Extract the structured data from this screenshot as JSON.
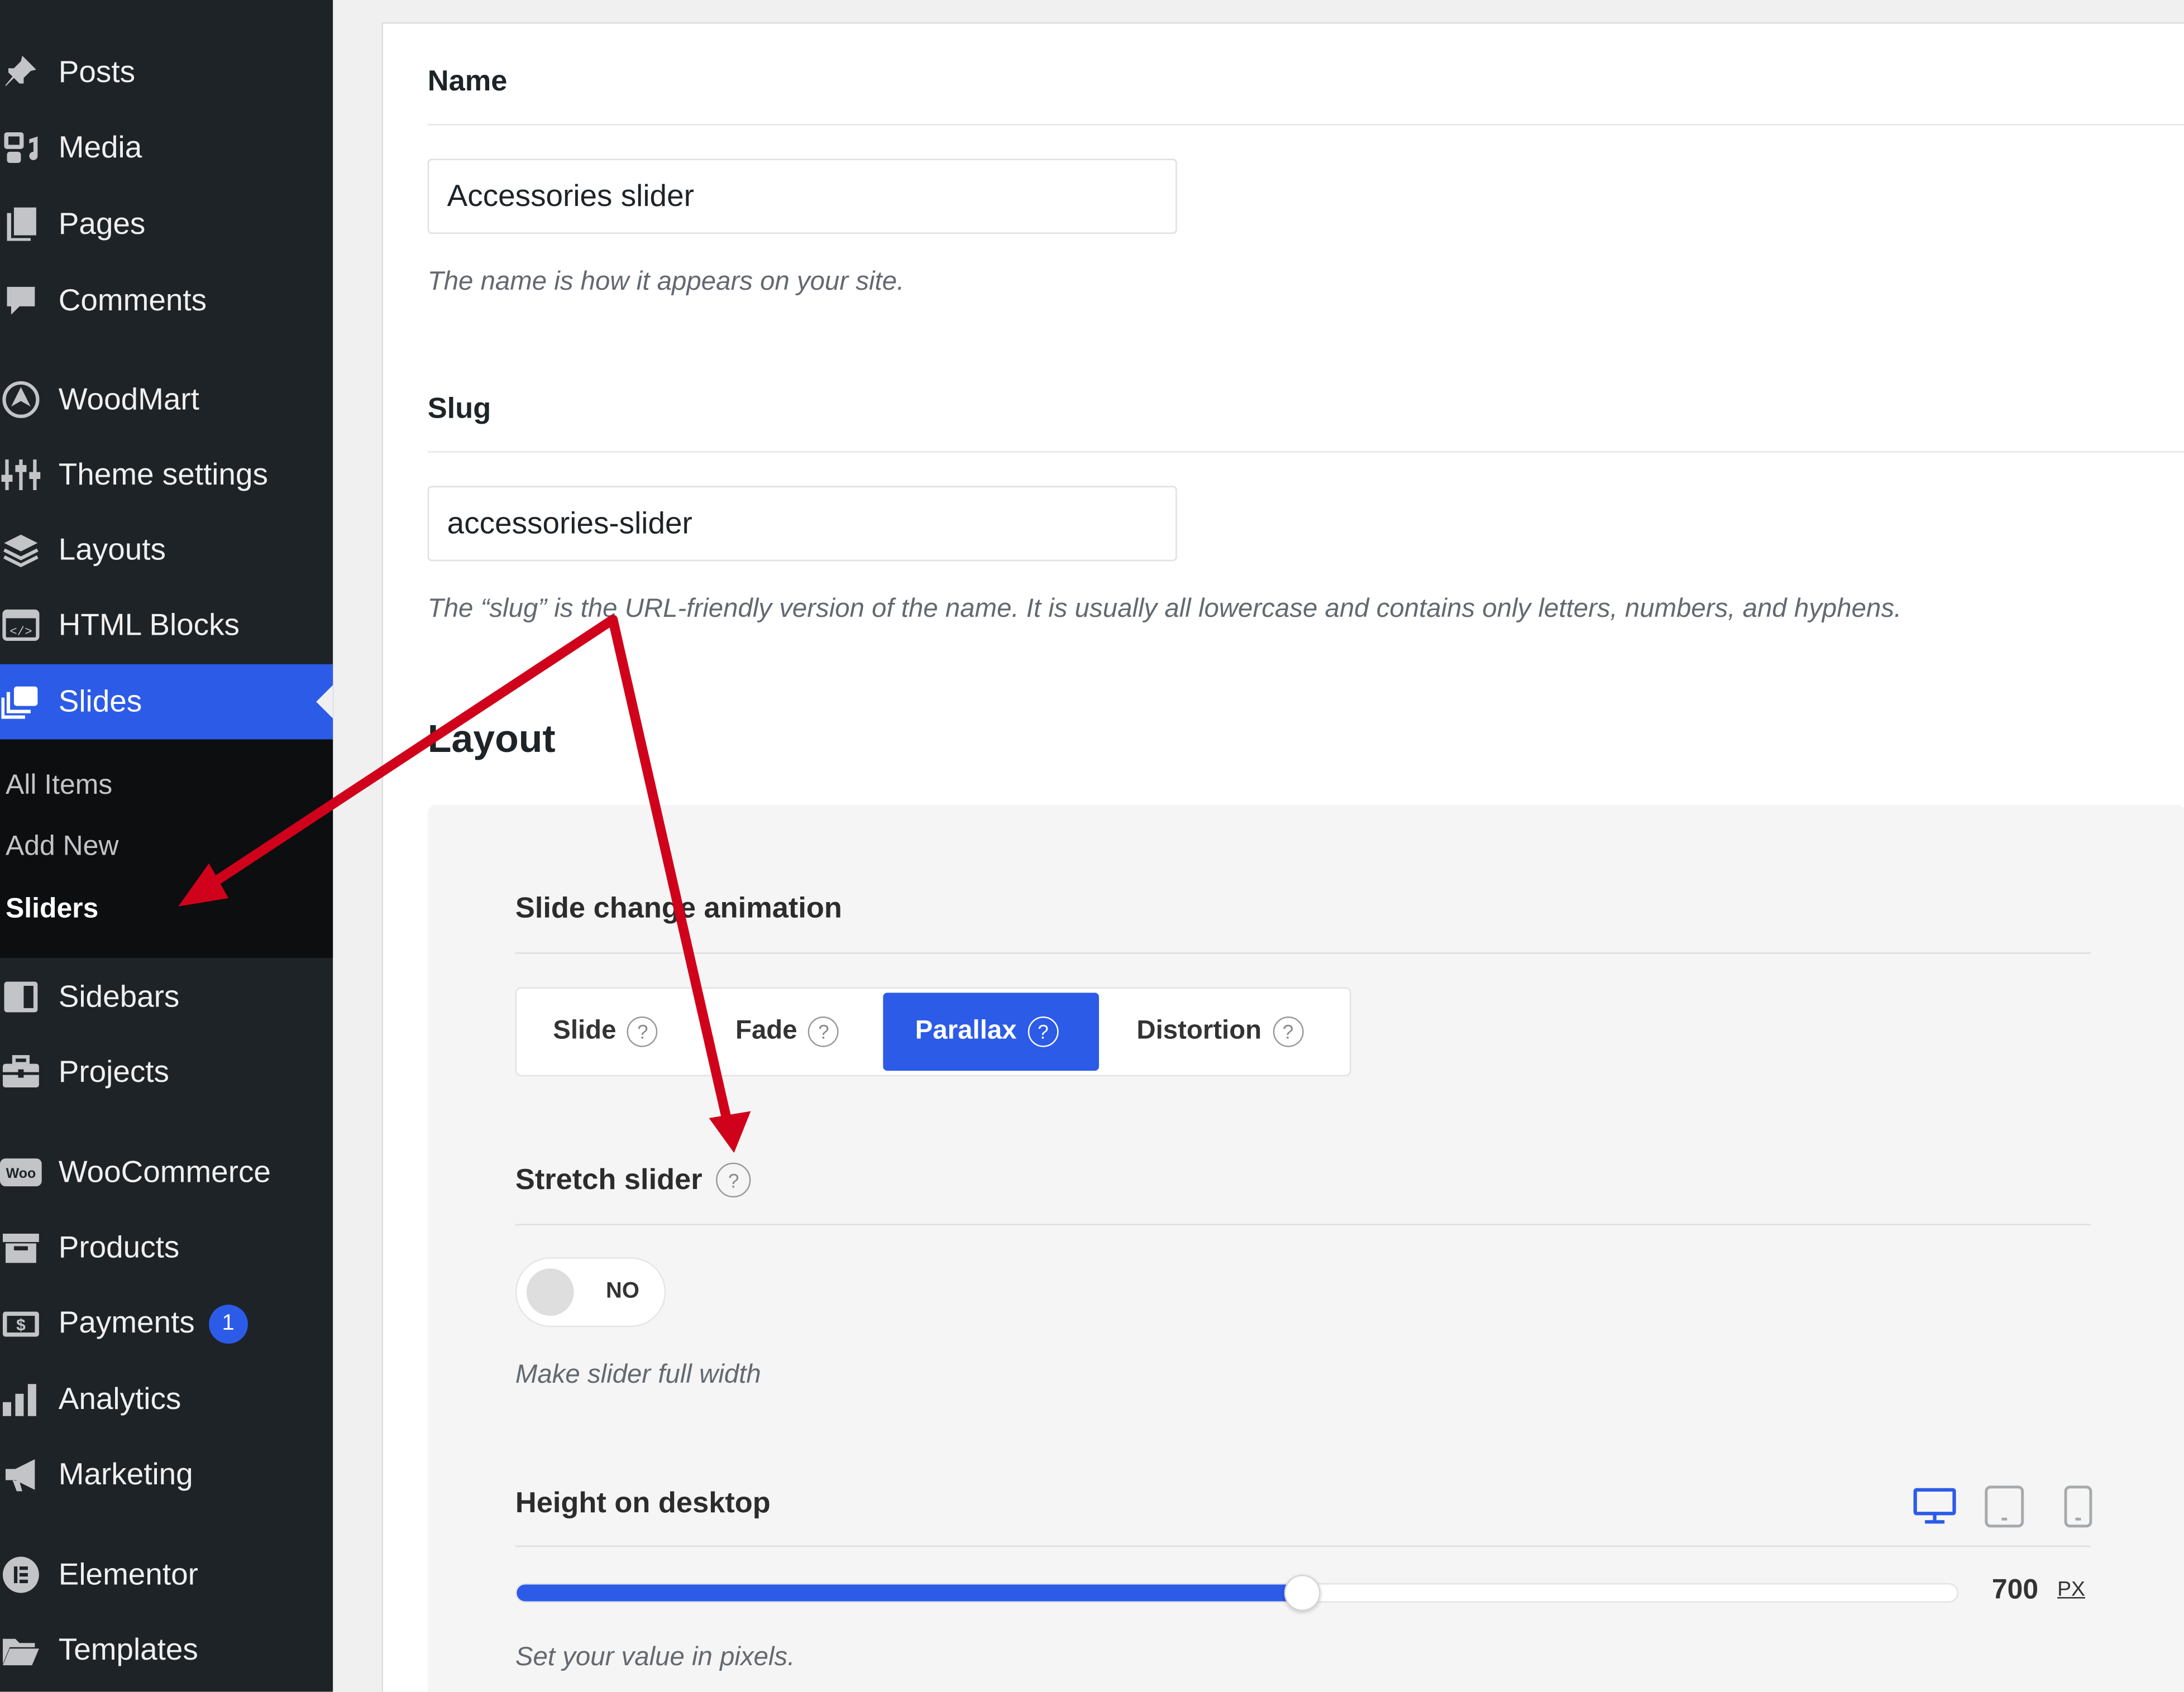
{
  "sidebar": {
    "items": [
      {
        "label": "Posts",
        "icon": "pin-icon"
      },
      {
        "label": "Media",
        "icon": "media-icon"
      },
      {
        "label": "Pages",
        "icon": "pages-icon"
      },
      {
        "label": "Comments",
        "icon": "comment-icon"
      },
      {
        "label": "WoodMart",
        "icon": "woodmart-icon"
      },
      {
        "label": "Theme settings",
        "icon": "sliders-icon"
      },
      {
        "label": "Layouts",
        "icon": "layers-icon"
      },
      {
        "label": "HTML Blocks",
        "icon": "code-icon"
      },
      {
        "label": "Slides",
        "icon": "slides-icon"
      },
      {
        "label": "Sidebars",
        "icon": "sidebar-icon"
      },
      {
        "label": "Projects",
        "icon": "briefcase-icon"
      },
      {
        "label": "WooCommerce",
        "icon": "woo-icon"
      },
      {
        "label": "Products",
        "icon": "archive-icon"
      },
      {
        "label": "Payments",
        "icon": "dollar-icon",
        "badge": "1"
      },
      {
        "label": "Analytics",
        "icon": "bar-chart-icon"
      },
      {
        "label": "Marketing",
        "icon": "megaphone-icon"
      },
      {
        "label": "Elementor",
        "icon": "elementor-icon"
      },
      {
        "label": "Templates",
        "icon": "folder-icon"
      }
    ],
    "submenu": [
      "All Items",
      "Add New",
      "Sliders"
    ],
    "woo_icon_text": "Woo",
    "accent_color": "#2c5be8"
  },
  "form": {
    "name": {
      "label": "Name",
      "value": "Accessories slider",
      "description": "The name is how it appears on your site."
    },
    "slug": {
      "label": "Slug",
      "value": "accessories-slider",
      "description": "The “slug” is the URL-friendly version of the name. It is usually all lowercase and contains only letters, numbers, and hyphens."
    },
    "layout_title": "Layout"
  },
  "layout": {
    "animation": {
      "label": "Slide change animation",
      "options": [
        "Slide",
        "Fade",
        "Parallax",
        "Distortion"
      ],
      "selected": "Parallax",
      "help": "?"
    },
    "stretch": {
      "label": "Stretch slider",
      "help": "?",
      "state": "NO",
      "description": "Make slider full width"
    },
    "height": {
      "label": "Height on desktop",
      "value": "700",
      "unit": "PX",
      "fill_fraction": 0.545,
      "description": "Set your value in pixels.",
      "devices": [
        "desktop-icon",
        "tablet-icon",
        "mobile-icon"
      ],
      "active_device": "desktop-icon"
    }
  },
  "annotation": {
    "color": "#d0021b"
  }
}
